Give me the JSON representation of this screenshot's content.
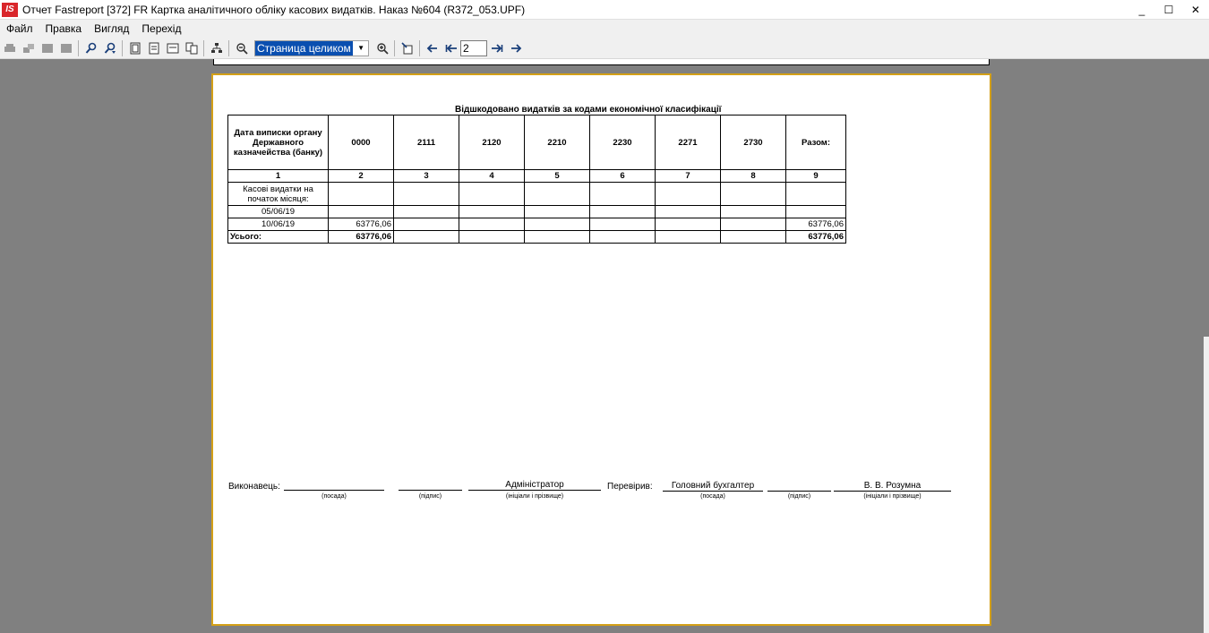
{
  "window": {
    "title": "Отчет Fastreport [372] FR Картка аналітичного обліку касових видатків. Наказ №604 (R372_053.UPF)",
    "logo": "IS",
    "minimize": "_",
    "maximize": "☐",
    "close": "✕"
  },
  "menu": [
    "Файл",
    "Правка",
    "Вигляд",
    "Перехід"
  ],
  "toolbar": {
    "zoom_value": "Страница целиком",
    "page_number": "2"
  },
  "report": {
    "title": "Відшкодовано видатків за кодами економічної класифікації",
    "headers": [
      "Дата виписки органу Державного казначейства (банку)",
      "0000",
      "2111",
      "2120",
      "2210",
      "2230",
      "2271",
      "2730",
      "Разом:"
    ],
    "numbers": [
      "1",
      "2",
      "3",
      "4",
      "5",
      "6",
      "7",
      "8",
      "9"
    ],
    "rows": [
      [
        "Касові видатки на початок місяця:",
        "",
        "",
        "",
        "",
        "",
        "",
        "",
        ""
      ],
      [
        "05/06/19",
        "",
        "",
        "",
        "",
        "",
        "",
        "",
        ""
      ],
      [
        "10/06/19",
        "63776,06",
        "",
        "",
        "",
        "",
        "",
        "",
        "63776,06"
      ]
    ],
    "total": [
      "Усього:",
      "63776,06",
      "",
      "",
      "",
      "",
      "",
      "",
      "63776,06"
    ]
  },
  "signatures": {
    "executor_label": "Виконавець:",
    "executor_position": "",
    "executor_position_caption": "(посада)",
    "executor_signature": "",
    "executor_signature_caption": "(підпис)",
    "executor_name": "Адміністратор",
    "executor_name_caption": "(ініціали і прізвище)",
    "checker_label": "Перевірив:",
    "checker_position": "Головний бухгалтер",
    "checker_position_caption": "(посада)",
    "checker_signature": "",
    "checker_signature_caption": "(підпис)",
    "checker_name": "В. В. Розумна",
    "checker_name_caption": "(ініціали і прізвище)"
  }
}
